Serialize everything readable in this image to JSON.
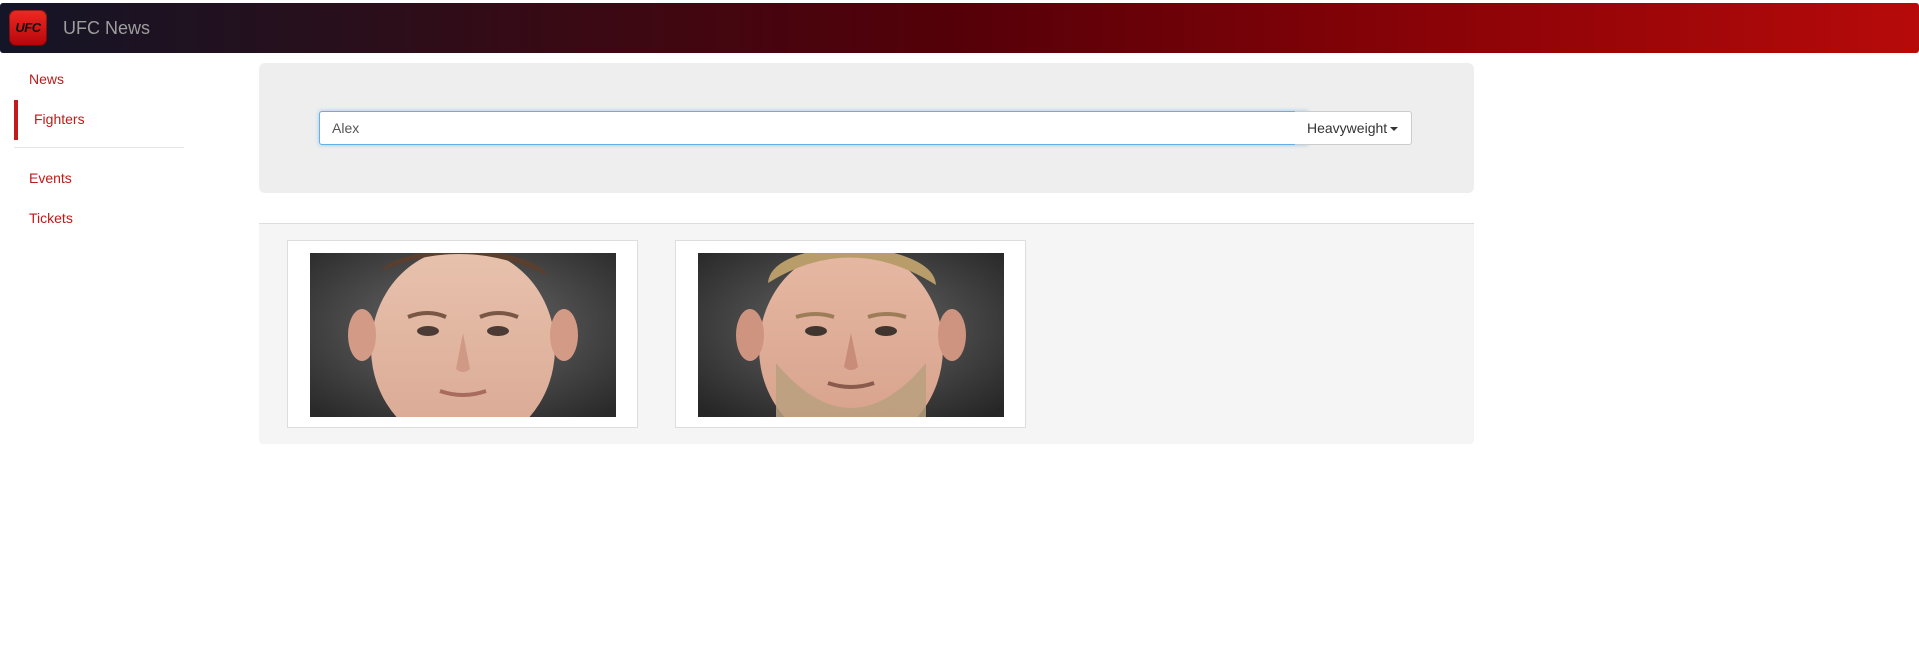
{
  "app": {
    "brand": "UFC News",
    "logo_text": "UFC"
  },
  "sidebar": {
    "items": [
      {
        "label": "News",
        "active": false
      },
      {
        "label": "Fighters",
        "active": true
      },
      {
        "label": "Events",
        "active": false
      },
      {
        "label": "Tickets",
        "active": false
      }
    ]
  },
  "search": {
    "value": "Alex",
    "weight_class": "Heavyweight"
  },
  "results": {
    "fighters": [
      {
        "photo": "fighter-headshot-1"
      },
      {
        "photo": "fighter-headshot-2"
      }
    ]
  },
  "colors": {
    "accent": "#c01818",
    "navbar_start": "#141527",
    "navbar_end": "#b70a0a",
    "well": "#eeeeee"
  },
  "icons": {
    "logo": "ufc-logo-icon",
    "dropdown": "caret-down-icon"
  }
}
